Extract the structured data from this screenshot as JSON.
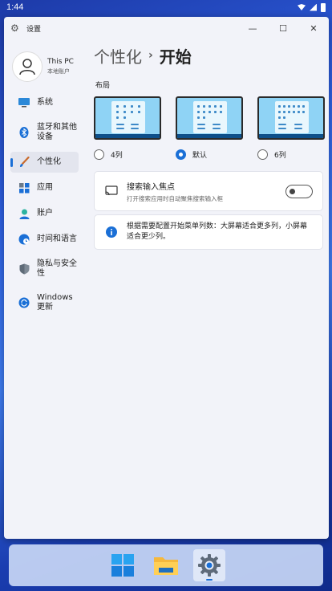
{
  "status_bar": {
    "time": "1:44"
  },
  "window": {
    "title": "设置",
    "controls": {
      "minimize": "—",
      "maximize": "☐",
      "close": "✕"
    }
  },
  "profile": {
    "name": "This PC",
    "subtitle": "本地账户"
  },
  "sidebar": {
    "items": [
      {
        "label": "系统",
        "icon": "monitor-icon"
      },
      {
        "label": "蓝牙和其他设备",
        "icon": "bluetooth-icon"
      },
      {
        "label": "个性化",
        "icon": "brush-icon",
        "active": true
      },
      {
        "label": "应用",
        "icon": "apps-icon"
      },
      {
        "label": "账户",
        "icon": "person-icon"
      },
      {
        "label": "时间和语言",
        "icon": "globe-clock-icon"
      },
      {
        "label": "隐私与安全性",
        "icon": "shield-icon"
      },
      {
        "label": "Windows 更新",
        "icon": "update-icon"
      }
    ]
  },
  "main": {
    "breadcrumb_parent": "个性化",
    "breadcrumb_sep": "›",
    "page_title": "开始",
    "section_label": "布局",
    "layout_options": [
      {
        "label": "4列",
        "selected": false
      },
      {
        "label": "默认",
        "selected": true
      },
      {
        "label": "6列",
        "selected": false
      }
    ],
    "focus_card": {
      "title": "搜索输入焦点",
      "subtitle": "打开搜索应用时自动聚焦搜索输入框",
      "toggle_on": false
    },
    "info_card": {
      "text": "根据需要配置开始菜单列数：大屏幕适合更多列，小屏幕适合更少列。"
    }
  },
  "taskbar": {
    "items": [
      {
        "icon": "windows-start-icon"
      },
      {
        "icon": "file-explorer-icon"
      },
      {
        "icon": "settings-gear-icon",
        "active": true
      }
    ]
  },
  "colors": {
    "accent": "#1a6fd6",
    "window_bg": "#f2f3f9"
  }
}
